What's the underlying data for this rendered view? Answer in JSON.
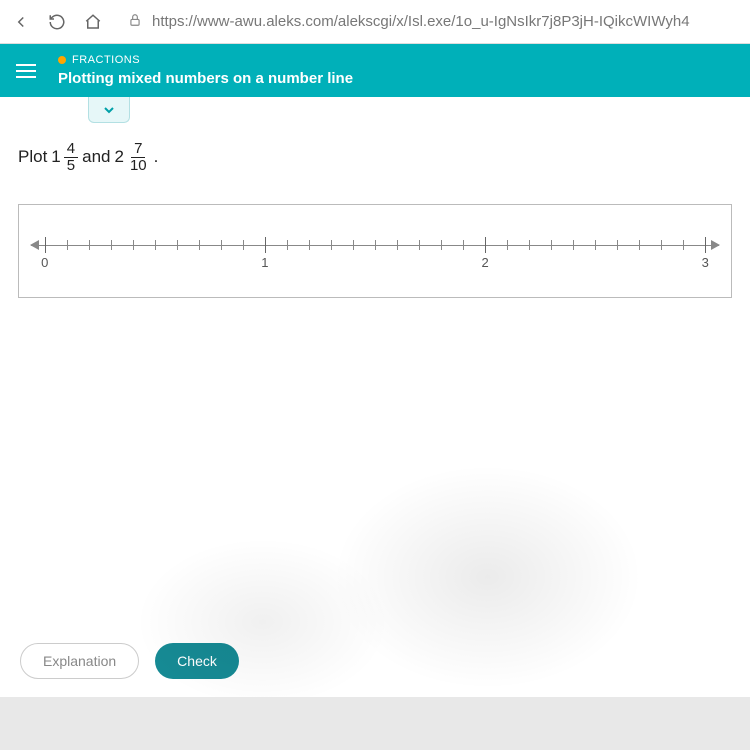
{
  "browser": {
    "url": "https://www-awu.aleks.com/alekscgi/x/Isl.exe/1o_u-IgNsIkr7j8P3jH-IQikcWIWyh4"
  },
  "header": {
    "category": "FRACTIONS",
    "title": "Plotting mixed numbers on a number line"
  },
  "question": {
    "prefix": "Plot",
    "mixed1_whole": "1",
    "mixed1_num": "4",
    "mixed1_den": "5",
    "between": "and",
    "mixed2_whole": "2",
    "mixed2_num": "7",
    "mixed2_den": "10",
    "suffix": "."
  },
  "numberline": {
    "min": 0,
    "max": 3,
    "minor_divisions_per_unit": 10,
    "labels": [
      "0",
      "1",
      "2",
      "3"
    ]
  },
  "buttons": {
    "explanation": "Explanation",
    "check": "Check"
  }
}
